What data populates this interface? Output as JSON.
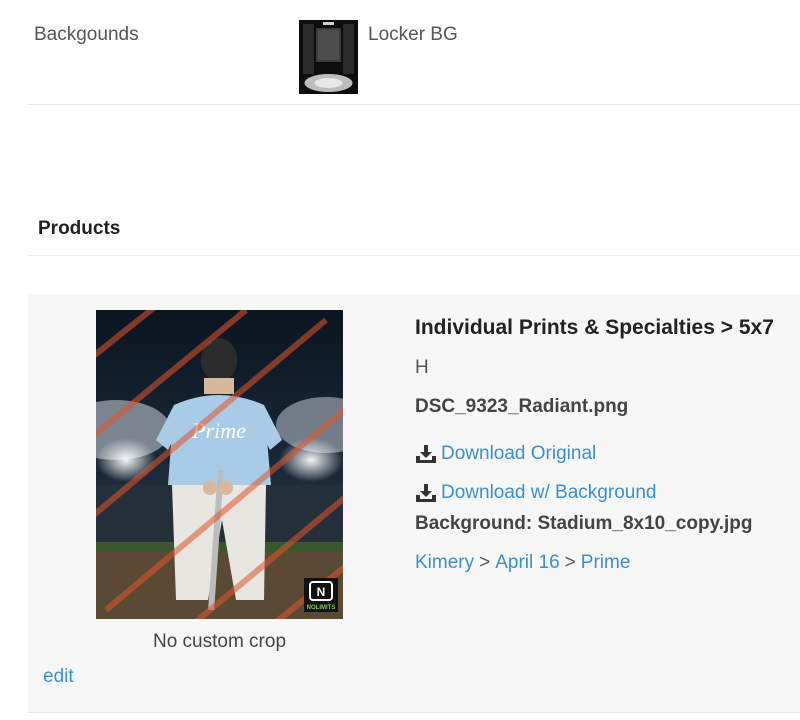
{
  "background_row": {
    "label": "Backgounds",
    "name": "Locker BG"
  },
  "products_section": {
    "title": "Products"
  },
  "product": {
    "title": "Individual Prints & Specialties > 5x7",
    "option": "H",
    "filename": "DSC_9323_Radiant.png",
    "download_original": "Download Original",
    "download_with_bg": "Download w/ Background",
    "background_info": "Background: Stadium_8x10_copy.jpg",
    "breadcrumb": [
      "Kimery",
      "April 16",
      "Prime"
    ],
    "breadcrumb_separator": ">",
    "crop_note": "No custom crop",
    "edit_label": "edit",
    "jersey_text": "Prime",
    "logo_text": "NOLIMITS"
  },
  "colors": {
    "link": "#3a8fd0",
    "jersey": "#a9cbe6"
  }
}
